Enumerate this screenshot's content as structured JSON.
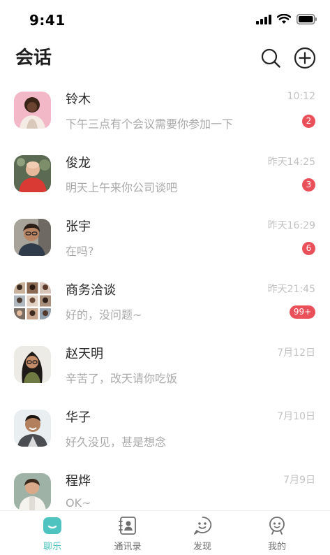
{
  "status_bar": {
    "time": "9:41"
  },
  "header": {
    "title": "会话"
  },
  "conversations": [
    {
      "name": "铃木",
      "time": "10:12",
      "preview": "下午三点有个会议需要你参加一下",
      "badge": "2",
      "avatar": "woman-curly-hair-pink-background"
    },
    {
      "name": "俊龙",
      "time": "昨天14:25",
      "preview": "明天上午来你公司谈吧",
      "badge": "3",
      "avatar": "bald-man-red-shirt"
    },
    {
      "name": "张宇",
      "time": "昨天16:29",
      "preview": "在吗?",
      "badge": "6",
      "avatar": "man-glasses-smiling"
    },
    {
      "name": "商务洽谈",
      "time": "昨天21:45",
      "preview": "好的，没问题~",
      "badge": "99+",
      "avatar": "group-grid"
    },
    {
      "name": "赵天明",
      "time": "7月12日",
      "preview": "辛苦了，改天请你吃饭",
      "badge": "",
      "avatar": "woman-glasses-long-hair"
    },
    {
      "name": "华子",
      "time": "7月10日",
      "preview": "好久没见，甚是想念",
      "badge": "",
      "avatar": "man-smiling-outdoor"
    },
    {
      "name": "程烨",
      "time": "7月9日",
      "preview": "OK~",
      "badge": "",
      "avatar": "woman-short-hair-white"
    }
  ],
  "tabs": [
    {
      "label": "聊乐",
      "icon": "chat-icon",
      "active": true
    },
    {
      "label": "通讯录",
      "icon": "contacts-icon",
      "active": false
    },
    {
      "label": "发现",
      "icon": "discover-icon",
      "active": false
    },
    {
      "label": "我的",
      "icon": "profile-icon",
      "active": false
    }
  ],
  "colors": {
    "accent": "#4fc3c0",
    "badge": "#e9505a",
    "muted_text": "#a9a9a9",
    "time_text": "#c2c2c2"
  }
}
